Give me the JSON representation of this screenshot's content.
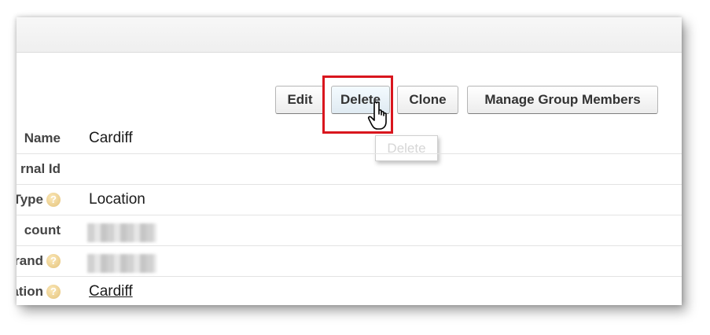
{
  "toolbar": {
    "edit_label": "Edit",
    "delete_label": "Delete",
    "clone_label": "Clone",
    "manage_label": "Manage Group Members"
  },
  "tooltip": {
    "text": "Delete"
  },
  "fields": [
    {
      "label": "Name",
      "value": "Cardiff",
      "help": false
    },
    {
      "label": "rnal Id",
      "value": "",
      "help": false
    },
    {
      "label": "Type",
      "value": "Location",
      "help": true
    },
    {
      "label": "count",
      "value": "",
      "help": false,
      "blurred": true
    },
    {
      "label": "Brand",
      "value": "",
      "help": true,
      "blurred": true
    },
    {
      "label": "cation",
      "value": "Cardiff",
      "help": true,
      "link": true
    }
  ],
  "icons": {
    "help": "question-mark-circle-icon",
    "cursor": "hand-pointer-icon"
  },
  "colors": {
    "highlight": "#d9161e",
    "help_icon": "#e4c27a"
  }
}
